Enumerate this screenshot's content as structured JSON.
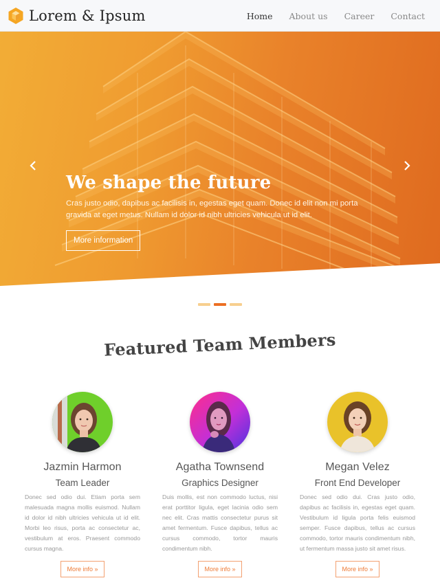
{
  "navbar": {
    "brand": "Lorem & Ipsum",
    "links": [
      {
        "label": "Home",
        "active": true
      },
      {
        "label": "About us",
        "active": false
      },
      {
        "label": "Career",
        "active": false
      },
      {
        "label": "Contact",
        "active": false
      }
    ]
  },
  "hero": {
    "title": "We shape the future",
    "text": "Cras justo odio, dapibus ac facilisis in, egestas eget quam. Donec id elit non mi porta gravida at eget metus. Nullam id dolor id nibh ultricies vehicula ut id elit.",
    "button": "More information",
    "prev_icon": "chevron-left-icon",
    "next_icon": "chevron-right-icon",
    "slides": 3,
    "active_slide": 2
  },
  "section": {
    "title": "Featured Team Members"
  },
  "team": [
    {
      "name": "Jazmin Harmon",
      "role": "Team Leader",
      "bio": "Donec sed odio dui. Etiam porta sem malesuada magna mollis euismod. Nullam id dolor id nibh ultricies vehicula ut id elit. Morbi leo risus, porta ac consectetur ac, vestibulum at eros. Praesent commodo cursus magna.",
      "button": "More info »"
    },
    {
      "name": "Agatha Townsend",
      "role": "Graphics Designer",
      "bio": "Duis mollis, est non commodo luctus, nisi erat porttitor ligula, eget lacinia odio sem nec elit. Cras mattis consectetur purus sit amet fermentum. Fusce dapibus, tellus ac cursus commodo, tortor mauris condimentum nibh.",
      "button": "More info »"
    },
    {
      "name": "Megan Velez",
      "role": "Front End Developer",
      "bio": "Donec sed odio dui. Cras justo odio, dapibus ac facilisis in, egestas eget quam. Vestibulum id ligula porta felis euismod semper. Fusce dapibus, tellus ac cursus commodo, tortor mauris condimentum nibh, ut fermentum massa justo sit amet risus.",
      "button": "More info »"
    }
  ],
  "colors": {
    "accent": "#ec6f23",
    "accent_light": "#f7cf8e",
    "hero_start": "#f2ad36",
    "hero_end": "#df6a1f"
  }
}
